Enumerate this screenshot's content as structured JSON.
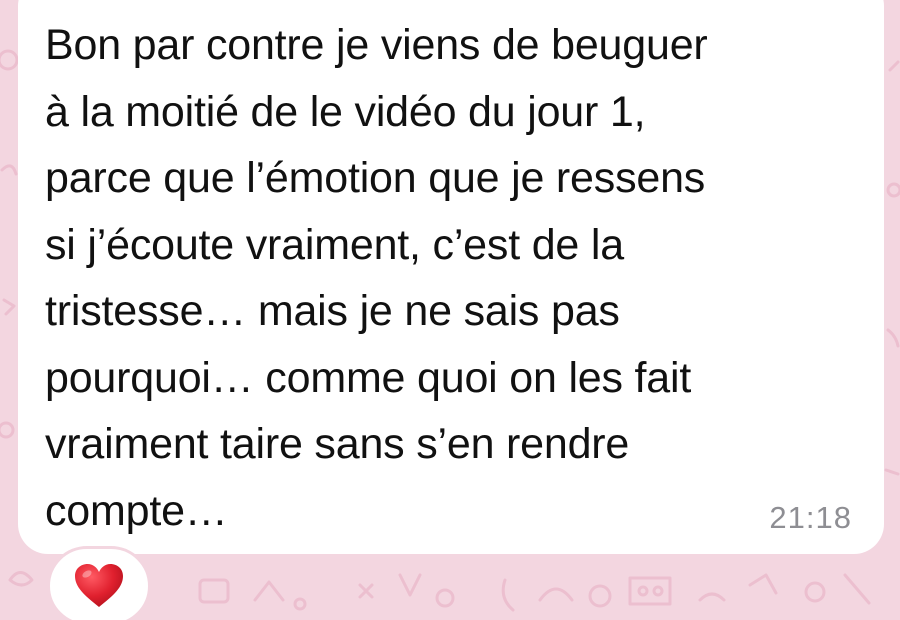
{
  "message": {
    "text": "Bon par contre je viens de beuguer\nà la moitié de le vidéo du jour 1,\nparce que l’émotion que je ressens\nsi j’écoute vraiment, c’est de la\ntristesse… mais je ne sais pas\npourquoi… comme quoi on les fait\nvraiment taire sans s’en rendre\ncompte…",
    "time": "21:18"
  },
  "reaction": {
    "icon": "heart-icon",
    "color": "#e0202e"
  },
  "colors": {
    "wallpaper": "#f3d6e0",
    "bubble": "#ffffff",
    "text": "#111111",
    "timestamp": "#8e8e93"
  }
}
